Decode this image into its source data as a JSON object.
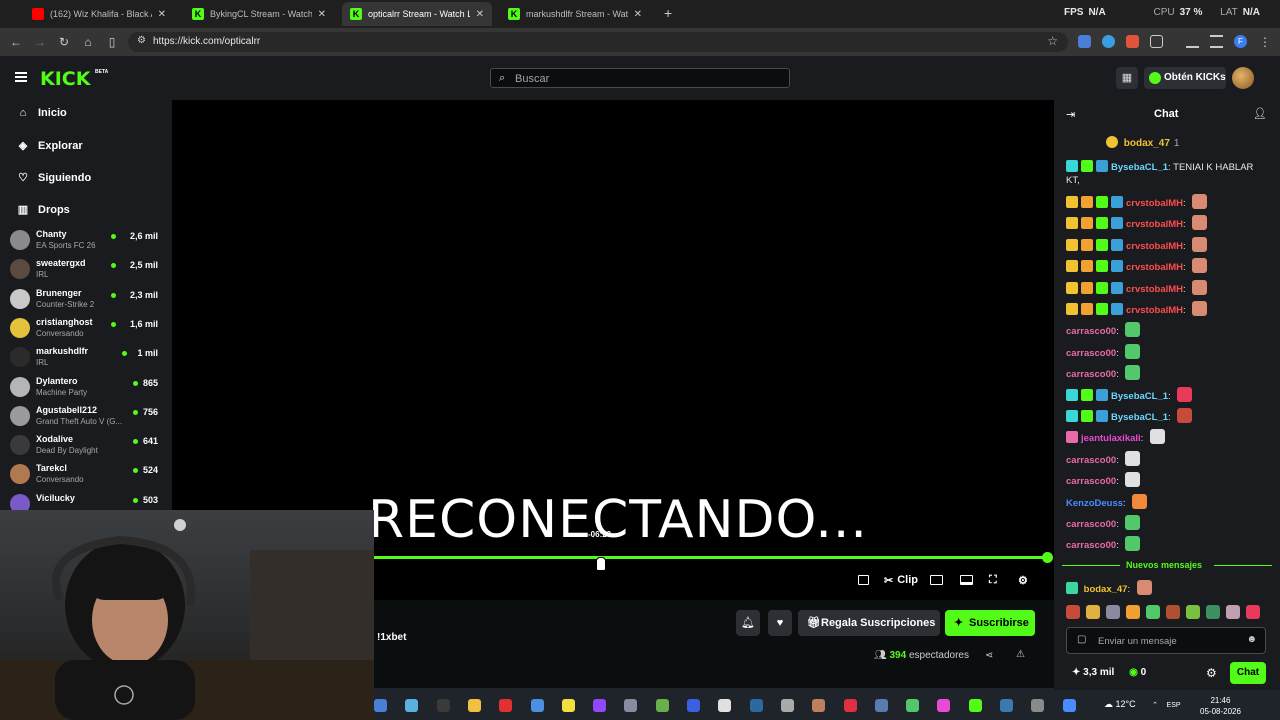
{
  "browser": {
    "tabs": [
      {
        "title": "(162) Wiz Khalifa - Black And Ye",
        "icon": "youtube-icon",
        "color": "#ff0000",
        "active": false
      },
      {
        "title": "BykingCL Stream - Watch Live o",
        "icon": "kick-icon",
        "color": "#53fc18",
        "active": false
      },
      {
        "title": "opticalrr Stream - Watch Live o",
        "icon": "kick-icon",
        "color": "#53fc18",
        "active": true
      },
      {
        "title": "markushdlfr Stream - Watch Liv",
        "icon": "kick-icon",
        "color": "#53fc18",
        "active": false
      }
    ],
    "url": "https://kick.com/opticalrr",
    "perf": {
      "fps_label": "FPS",
      "fps": "N/A",
      "cpu_label": "CPU",
      "cpu": "37 %",
      "lat_label": "LAT",
      "lat": "N/A"
    }
  },
  "kick": {
    "logo": "KICK",
    "beta": "BETA",
    "search_placeholder": "Buscar",
    "kicks_button": "Obtén KICKs",
    "accent": "#53fc18"
  },
  "sidebar": {
    "nav": [
      {
        "label": "Inicio",
        "icon": "home-icon"
      },
      {
        "label": "Explorar",
        "icon": "compass-icon"
      },
      {
        "label": "Siguiendo",
        "icon": "heart-icon"
      },
      {
        "label": "Drops",
        "icon": "chart-icon"
      }
    ],
    "channels": [
      {
        "name": "Chanty",
        "game": "EA Sports FC 26",
        "viewers": "2,6 mil",
        "avatar": "#8a8a8a"
      },
      {
        "name": "sweatergxd",
        "game": "IRL",
        "viewers": "2,5 mil",
        "avatar": "#5a4a40"
      },
      {
        "name": "Brunenger",
        "game": "Counter-Strike 2",
        "viewers": "2,3 mil",
        "avatar": "#c9c9c9"
      },
      {
        "name": "cristianghost",
        "game": "Conversando",
        "viewers": "1,6 mil",
        "avatar": "#e2c23a"
      },
      {
        "name": "markushdlfr",
        "game": "IRL",
        "viewers": "1 mil",
        "avatar": "#2b2b2b"
      },
      {
        "name": "Dylantero",
        "game": "Machine Party",
        "viewers": "865",
        "avatar": "#b5b5b5"
      },
      {
        "name": "Agustabell212",
        "game": "Grand Theft Auto V (G...",
        "viewers": "756",
        "avatar": "#9a9a9a"
      },
      {
        "name": "Xodalive",
        "game": "Dead By Daylight",
        "viewers": "641",
        "avatar": "#3a3a3a"
      },
      {
        "name": "Tarekcl",
        "game": "Conversando",
        "viewers": "524",
        "avatar": "#b07a50"
      },
      {
        "name": "Vicilucky",
        "game": "",
        "viewers": "503",
        "avatar": "#7a5ac8"
      }
    ]
  },
  "player": {
    "status": "RECONECTANDO...",
    "time": "-06:29",
    "progress": 1.0,
    "clip_label": "Clip",
    "sponsor": "!1xbet",
    "gift_button": "Regala Suscripciones",
    "subscribe_button": "Suscribirse",
    "viewers_count": "394",
    "viewers_label": "espectadores"
  },
  "chat": {
    "title": "Chat",
    "pinned_user": "bodax_47",
    "pinned_count": "1",
    "messages": [
      {
        "user": "BysebaCL_1",
        "color": "#6bd7ff",
        "text": "TENIAI K HABLAR KT,",
        "badges": [
          "#3ad7d7",
          "#53fc18",
          "#3aa0d7"
        ],
        "emote": ""
      },
      {
        "user": "crvstobalMH",
        "color": "#ff4d4d",
        "text": "",
        "badges": [
          "#f1c232",
          "#f1a032",
          "#53fc18",
          "#3aa0d7"
        ],
        "emote": "#d98a72"
      },
      {
        "user": "crvstobalMH",
        "color": "#ff4d4d",
        "text": "",
        "badges": [
          "#f1c232",
          "#f1a032",
          "#53fc18",
          "#3aa0d7"
        ],
        "emote": "#d98a72"
      },
      {
        "user": "crvstobalMH",
        "color": "#ff4d4d",
        "text": "",
        "badges": [
          "#f1c232",
          "#f1a032",
          "#53fc18",
          "#3aa0d7"
        ],
        "emote": "#d98a72"
      },
      {
        "user": "crvstobalMH",
        "color": "#ff4d4d",
        "text": "",
        "badges": [
          "#f1c232",
          "#f1a032",
          "#53fc18",
          "#3aa0d7"
        ],
        "emote": "#d98a72"
      },
      {
        "user": "crvstobalMH",
        "color": "#ff4d4d",
        "text": "",
        "badges": [
          "#f1c232",
          "#f1a032",
          "#53fc18",
          "#3aa0d7"
        ],
        "emote": "#d98a72"
      },
      {
        "user": "crvstobalMH",
        "color": "#ff4d4d",
        "text": "",
        "badges": [
          "#f1c232",
          "#f1a032",
          "#53fc18",
          "#3aa0d7"
        ],
        "emote": "#d98a72"
      },
      {
        "user": "carrasco00",
        "color": "#e86ba8",
        "text": "",
        "badges": [],
        "emote": "#53c86b"
      },
      {
        "user": "carrasco00",
        "color": "#e86ba8",
        "text": "",
        "badges": [],
        "emote": "#53c86b"
      },
      {
        "user": "carrasco00",
        "color": "#e86ba8",
        "text": "",
        "badges": [],
        "emote": "#53c86b"
      },
      {
        "user": "BysebaCL_1",
        "color": "#6bd7ff",
        "text": "",
        "badges": [
          "#3ad7d7",
          "#53fc18",
          "#3aa0d7"
        ],
        "emote": "#e83a5a"
      },
      {
        "user": "BysebaCL_1",
        "color": "#6bd7ff",
        "text": "",
        "badges": [
          "#3ad7d7",
          "#53fc18",
          "#3aa0d7"
        ],
        "emote": "#c84a3a"
      },
      {
        "user": "jeantulaxikali",
        "color": "#e84ad7",
        "text": "",
        "badges": [
          "#e86ba8"
        ],
        "emote": "#e0e0e0"
      },
      {
        "user": "carrasco00",
        "color": "#e86ba8",
        "text": "",
        "badges": [],
        "emote": "#e0e0e0"
      },
      {
        "user": "carrasco00",
        "color": "#e86ba8",
        "text": "",
        "badges": [],
        "emote": "#e0e0e0"
      },
      {
        "user": "KenzoDeuss",
        "color": "#4a8cff",
        "text": "",
        "badges": [],
        "emote": "#f08a3a"
      },
      {
        "user": "carrasco00",
        "color": "#e86ba8",
        "text": "",
        "badges": [],
        "emote": "#53c86b"
      },
      {
        "user": "carrasco00",
        "color": "#e86ba8",
        "text": "",
        "badges": [],
        "emote": "#53c86b"
      }
    ],
    "new_messages_label": "Nuevos mensajes",
    "last_message": {
      "user": "bodax_47",
      "color": "#f1c232",
      "emote": "#d98a72"
    },
    "input_placeholder": "Enviar un mensaje",
    "send_label": "Chat",
    "kicks_balance": "3,3 mil",
    "kicks_other": "0"
  },
  "taskbar": {
    "weather": "12°C",
    "lang": "ESP",
    "time": "21:46",
    "date": "05-08-2026"
  }
}
